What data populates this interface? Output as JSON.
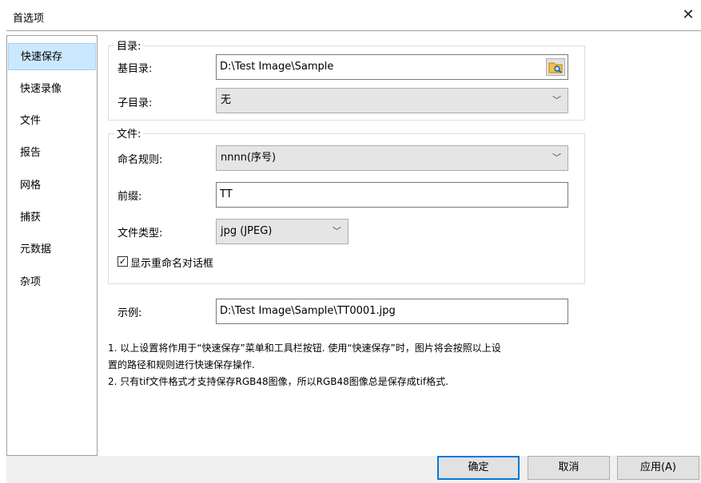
{
  "window": {
    "title": "首选项",
    "close_glyph": "✕"
  },
  "sidebar": {
    "items": [
      {
        "label": "快速保存",
        "selected": true
      },
      {
        "label": "快速录像"
      },
      {
        "label": "文件"
      },
      {
        "label": "报告"
      },
      {
        "label": "网格"
      },
      {
        "label": "捕获"
      },
      {
        "label": "元数据"
      },
      {
        "label": "杂项"
      }
    ]
  },
  "directory_group": {
    "title": "目录:",
    "base_label": "基目录:",
    "base_value": "D:\\Test Image\\Sample",
    "browse_icon": "folder-browse-icon",
    "sub_label": "子目录:",
    "sub_value": "无"
  },
  "file_group": {
    "title": "文件:",
    "naming_label": "命名规则:",
    "naming_value": "nnnn(序号)",
    "prefix_label": "前缀:",
    "prefix_value": "TT",
    "type_label": "文件类型:",
    "type_value": "jpg (JPEG)",
    "rename_checkbox_label": "显示重命名对话框",
    "rename_checked": true
  },
  "example": {
    "label": "示例:",
    "value": "D:\\Test Image\\Sample\\TT0001.jpg"
  },
  "notes": {
    "line1": "1. 以上设置将作用于“快速保存”菜单和工具栏按钮. 使用“快速保存”时，图片将会按照以上设",
    "line2": "置的路径和规则进行快速保存操作.",
    "line3": "2. 只有tif文件格式才支持保存RGB48图像，所以RGB48图像总是保存成tif格式."
  },
  "footer": {
    "ok_label": "确定",
    "cancel_label": "取消",
    "apply_label": "应用(A)"
  },
  "colors": {
    "selection_bg": "#cce8ff",
    "selection_border": "#99d1ff",
    "primary_border": "#0078d7"
  }
}
